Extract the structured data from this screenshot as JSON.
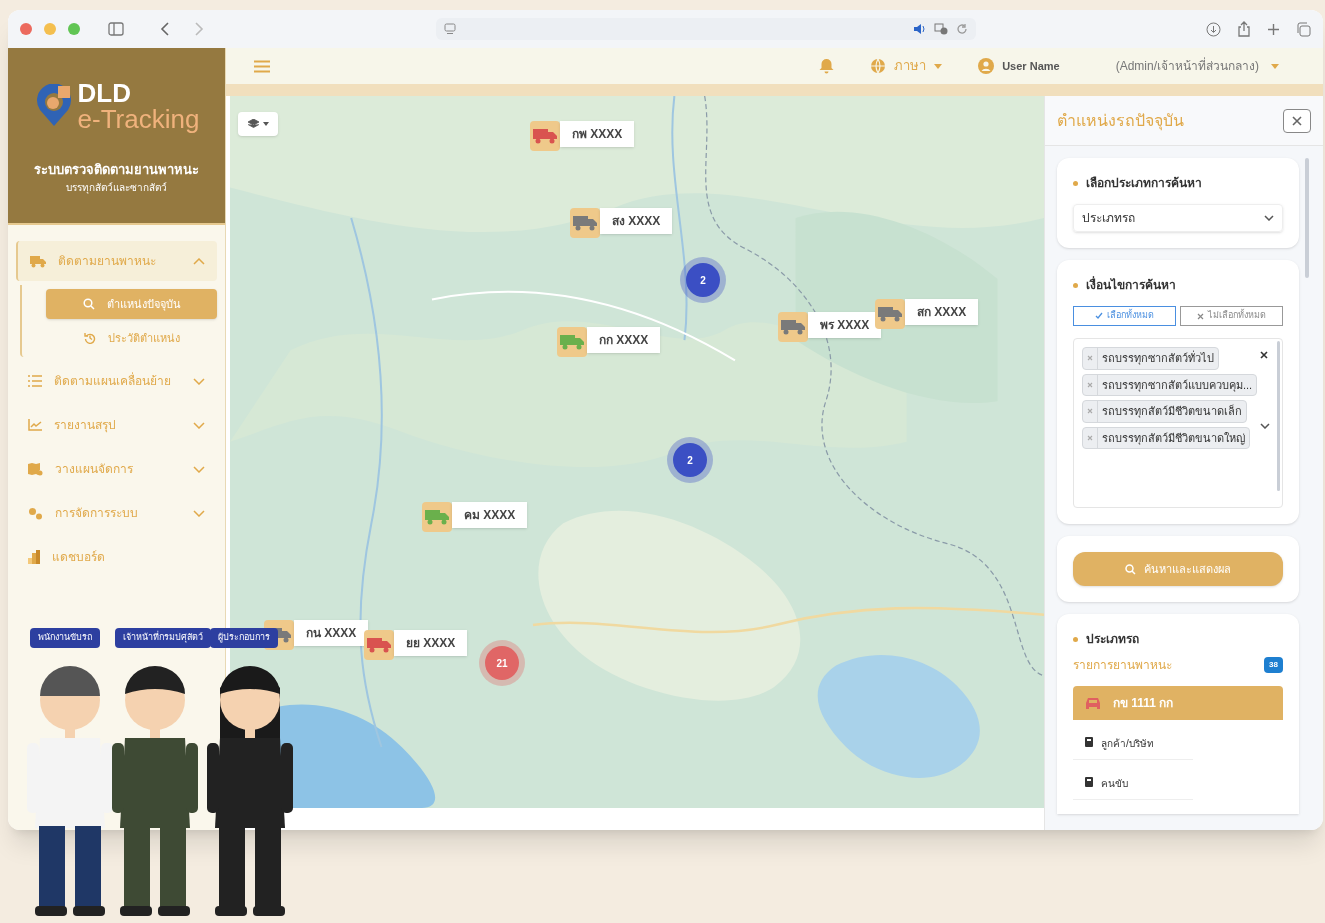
{
  "app": {
    "logo_line1": "DLD",
    "logo_line2": "e-Tracking",
    "system_title": "ระบบตรวจติดตามยานพาหนะ",
    "system_subtitle": "บรรทุกสัตว์และซากสัตว์"
  },
  "sidebar": {
    "items": [
      {
        "label": "ติดตามยานพาหนะ",
        "kind": "group",
        "expanded": true,
        "children": [
          {
            "label": "ตำแหน่งปัจจุบัน",
            "selected": true
          },
          {
            "label": "ประวัติตำแหน่ง",
            "selected": false
          }
        ]
      },
      {
        "label": "ติดตามแผนเคลื่อนย้าย",
        "kind": "group",
        "expanded": false
      },
      {
        "label": "รายงานสรุป",
        "kind": "group",
        "expanded": false
      },
      {
        "label": "วางแผนจัดการ",
        "kind": "group",
        "expanded": false
      },
      {
        "label": "การจัดการระบบ",
        "kind": "group",
        "expanded": false
      },
      {
        "label": "แดชบอร์ด",
        "kind": "link"
      }
    ]
  },
  "header": {
    "language": "ภาษา",
    "user_name": "User Name",
    "role": "(Admin/เจ้าหน้าที่ส่วนกลาง)"
  },
  "map": {
    "markers": [
      {
        "plate": "กพ XXXX",
        "color": "#d9534f"
      },
      {
        "plate": "สง XXXX",
        "color": "#7a7a7a"
      },
      {
        "plate": "กก XXXX",
        "color": "#6ab04c"
      },
      {
        "plate": "พร XXXX",
        "color": "#7a7a7a"
      },
      {
        "plate": "สก XXXX",
        "color": "#7a7a7a"
      },
      {
        "plate": "คม XXXX",
        "color": "#6ab04c"
      },
      {
        "plate": "กน XXXX",
        "color": "#7a7a7a"
      },
      {
        "plate": "ยย XXXX",
        "color": "#d9534f"
      }
    ],
    "clusters": [
      {
        "count": "2",
        "color": "#3b4fc4"
      },
      {
        "count": "2",
        "color": "#3b4fc4"
      },
      {
        "count": "21",
        "color": "#e06666"
      }
    ]
  },
  "panel": {
    "title": "ตำแหน่งรถปัจจุบัน",
    "search_type_label": "เลือกประเภทการค้นหา",
    "search_type_value": "ประเภทรถ",
    "conditions_label": "เงื่อนไขการค้นหา",
    "select_all": "เลือกทั้งหมด",
    "select_none": "ไม่เลือกทั้งหมด",
    "chips": [
      "รถบรรทุกซากสัตว์ทั่วไป",
      "รถบรรทุกซากสัตว์แบบควบคุม...",
      "รถบรรทุกสัตว์มีชีวิตขนาดเล็ก",
      "รถบรรทุกสัตว์มีชีวิตขนาดใหญ่"
    ],
    "search_button": "ค้นหาและแสดงผล",
    "result_type": "ประเภทรถ",
    "list_title": "รายการยานพาหนะ",
    "list_count": "38",
    "vehicle": {
      "plate": "กข 1111 กก",
      "fields": [
        "ลูกค้า/บริษัท",
        "คนขับ"
      ]
    }
  },
  "roles": [
    "พนักงานขับรถ",
    "เจ้าหน้าที่กรมปศุสัตว์",
    "ผู้ประกอบการ"
  ]
}
